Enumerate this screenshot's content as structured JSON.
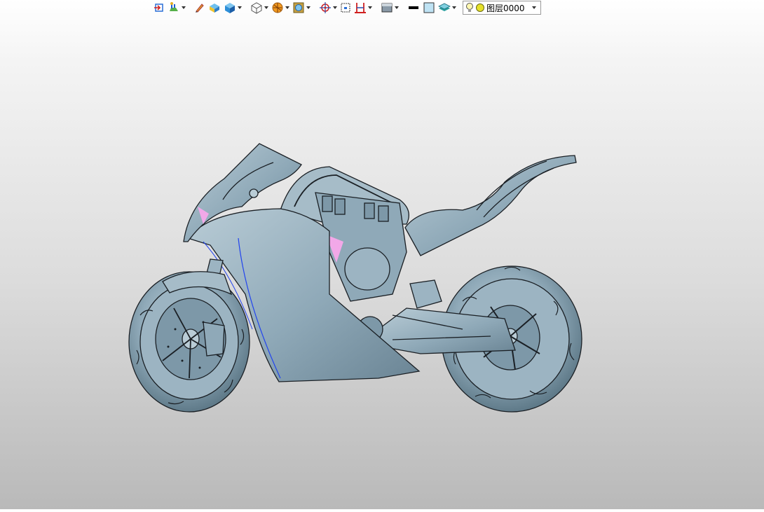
{
  "toolbar": {
    "icons": [
      "exit-sketch-icon",
      "snap-icon",
      "pencil-icon",
      "shaded-block-icon",
      "solid-cube-icon",
      "wireframe-cube-icon",
      "render-sphere-icon",
      "fit-view-icon",
      "origin-target-icon",
      "zoom-window-icon",
      "section-icon",
      "background-icon",
      "black-color-swatch",
      "light-blue-color-swatch",
      "layer-stack-icon"
    ],
    "layer": {
      "value": "图层0000",
      "bulb_icon": "lightbulb-icon",
      "status_icon": "layer-on-icon"
    }
  },
  "colors": {
    "model_fill": "#8fa9b8",
    "model_light": "#b9ccd6",
    "model_dark": "#56707f",
    "edge": "#1a1f24",
    "accent_blue": "#2244ee",
    "accent_pink": "#f2a8e8"
  }
}
